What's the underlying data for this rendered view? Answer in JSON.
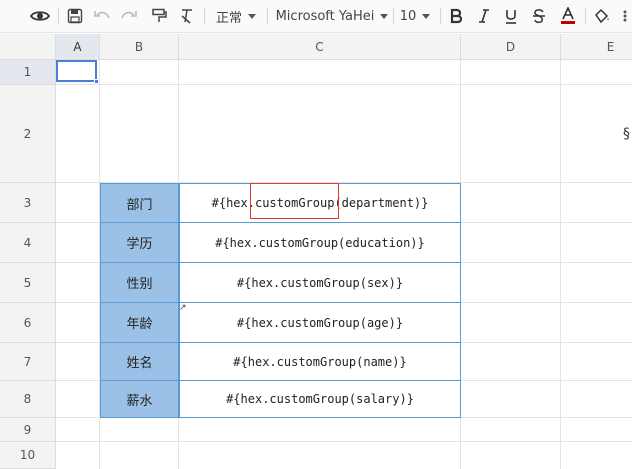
{
  "toolbar": {
    "style_value": "正常",
    "font_family": "Microsoft YaHei",
    "font_size": "10",
    "icons": [
      "eye-icon",
      "save-icon",
      "undo-icon",
      "redo-icon",
      "format-painter-icon",
      "clear-format-icon",
      "bold-icon",
      "italic-icon",
      "underline-icon",
      "strikethrough-icon",
      "font-color-icon",
      "fill-color-icon"
    ]
  },
  "columns": [
    "A",
    "B",
    "C",
    "D",
    "E"
  ],
  "rows": [
    "1",
    "2",
    "3",
    "4",
    "5",
    "6",
    "7",
    "8",
    "9",
    "10"
  ],
  "table": [
    {
      "label": "部门",
      "value": "#{hex.customGroup(department)}"
    },
    {
      "label": "学历",
      "value": "#{hex.customGroup(education)}"
    },
    {
      "label": "性别",
      "value": "#{hex.customGroup(sex)}"
    },
    {
      "label": "年龄",
      "value": "#{hex.customGroup(age)}"
    },
    {
      "label": "姓名",
      "value": "#{hex.customGroup(name)}"
    },
    {
      "label": "薪水",
      "value": "#{hex.customGroup(salary)}"
    }
  ],
  "colors": {
    "label_fill": "#9bc2e6",
    "table_border": "#5b9bd5",
    "selection": "#4a7fd4",
    "highlight": "#e03a3a",
    "font_color_underline": "#c00000"
  }
}
